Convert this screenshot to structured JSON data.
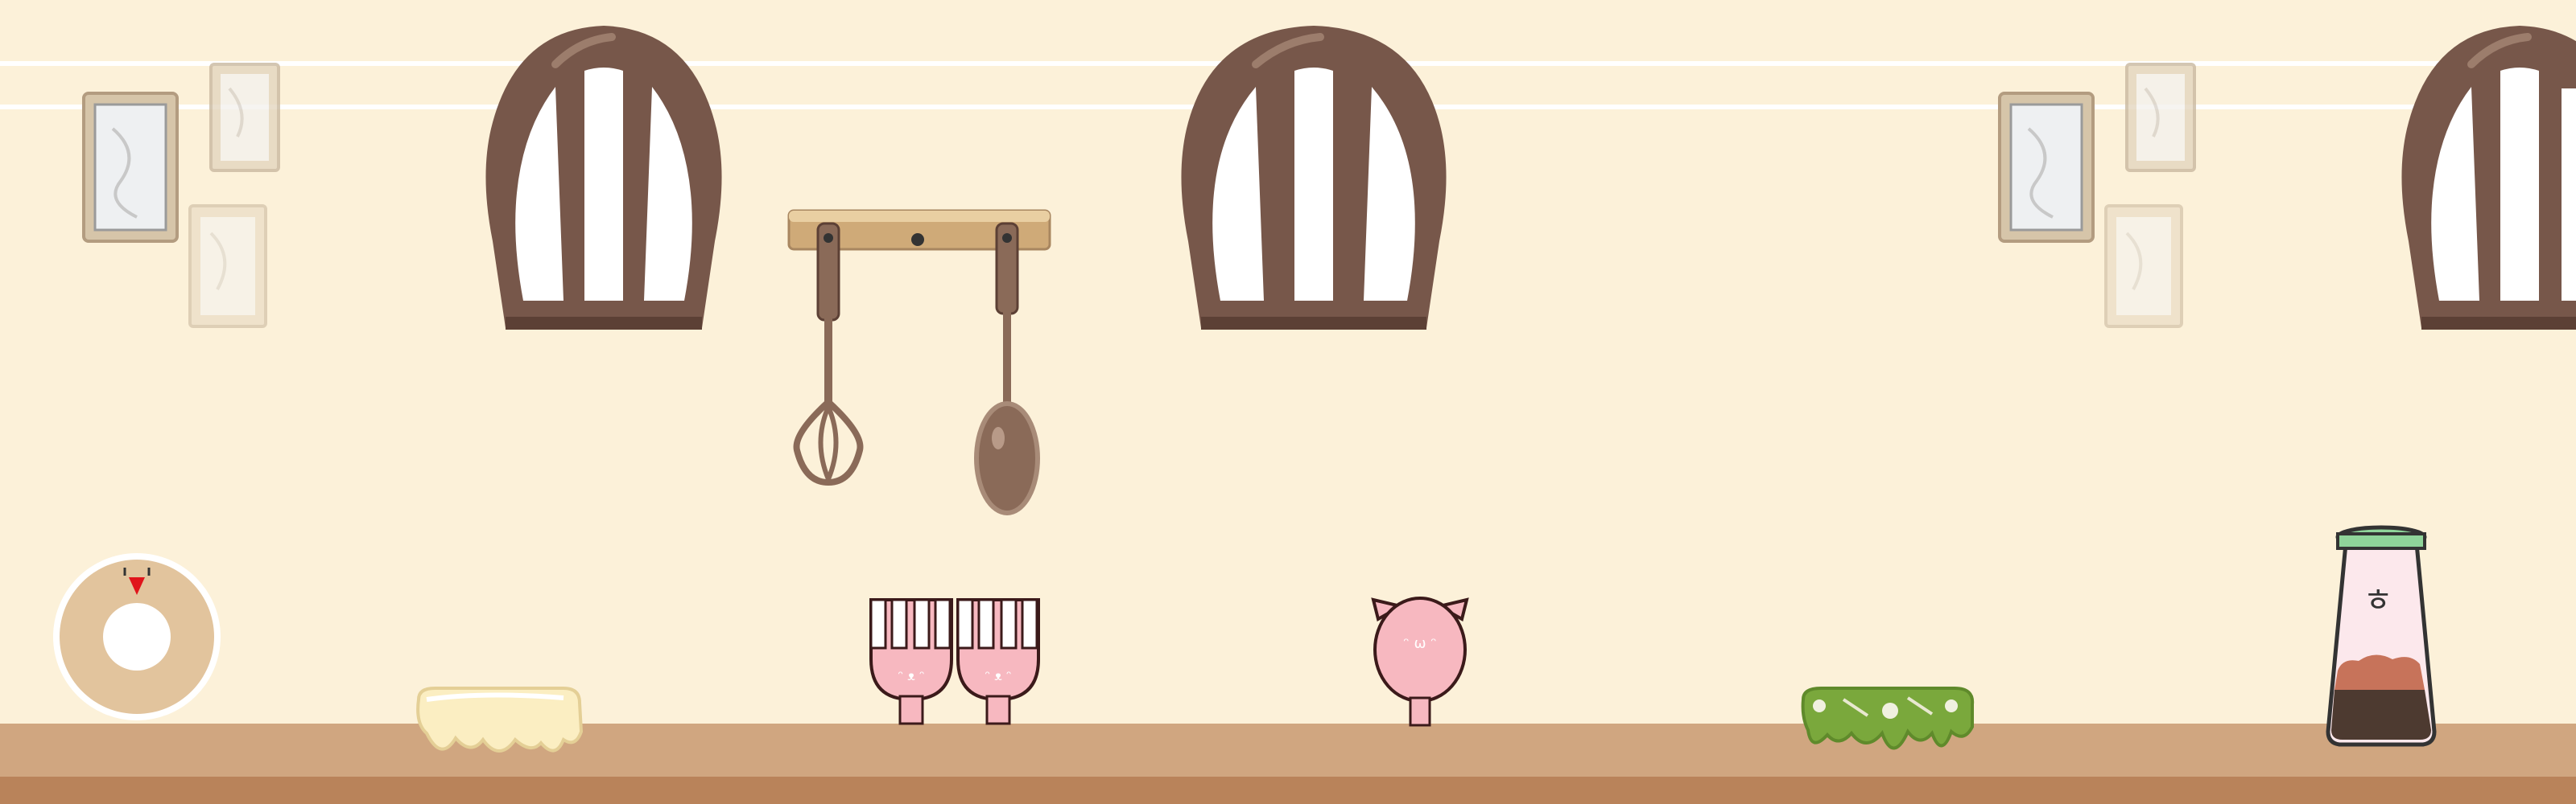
{
  "scene": {
    "name": "kitchen-wall",
    "colors": {
      "wall": "#fcf1d9",
      "wall_stripe": "#ffffff",
      "counter_top": "#d0a680",
      "counter_front": "#b9835a",
      "window_frame": "#77574a",
      "window_frame_dark": "#5c4035",
      "window_glass": "#ffffff",
      "frame_border": "#c9b8a0",
      "rack_board": "#cfaa78",
      "utensil_brown": "#8a6a58",
      "pink_character": "#f7b8c0",
      "donut": "#e2c49d",
      "cheese": "#fbeec2",
      "slime": "#7aa83c",
      "jar_lid": "#8fd49a",
      "jar_top_layer": "#c7735a",
      "jar_bottom_layer": "#4d3a30",
      "marker_red": "#e0141b"
    }
  },
  "icons": {
    "donut_ring": "donut-ring-icon",
    "timer_marker": "red-triangle-marker-icon",
    "whisk": "whisk-icon",
    "ladle": "ladle-icon",
    "fork_characters": "pink-fork-characters",
    "spoon_character": "pink-spoon-cat-character",
    "cheese": "melted-cheese-block",
    "slime": "green-slime-with-skulls",
    "jar": "salt-shaker-jar"
  }
}
